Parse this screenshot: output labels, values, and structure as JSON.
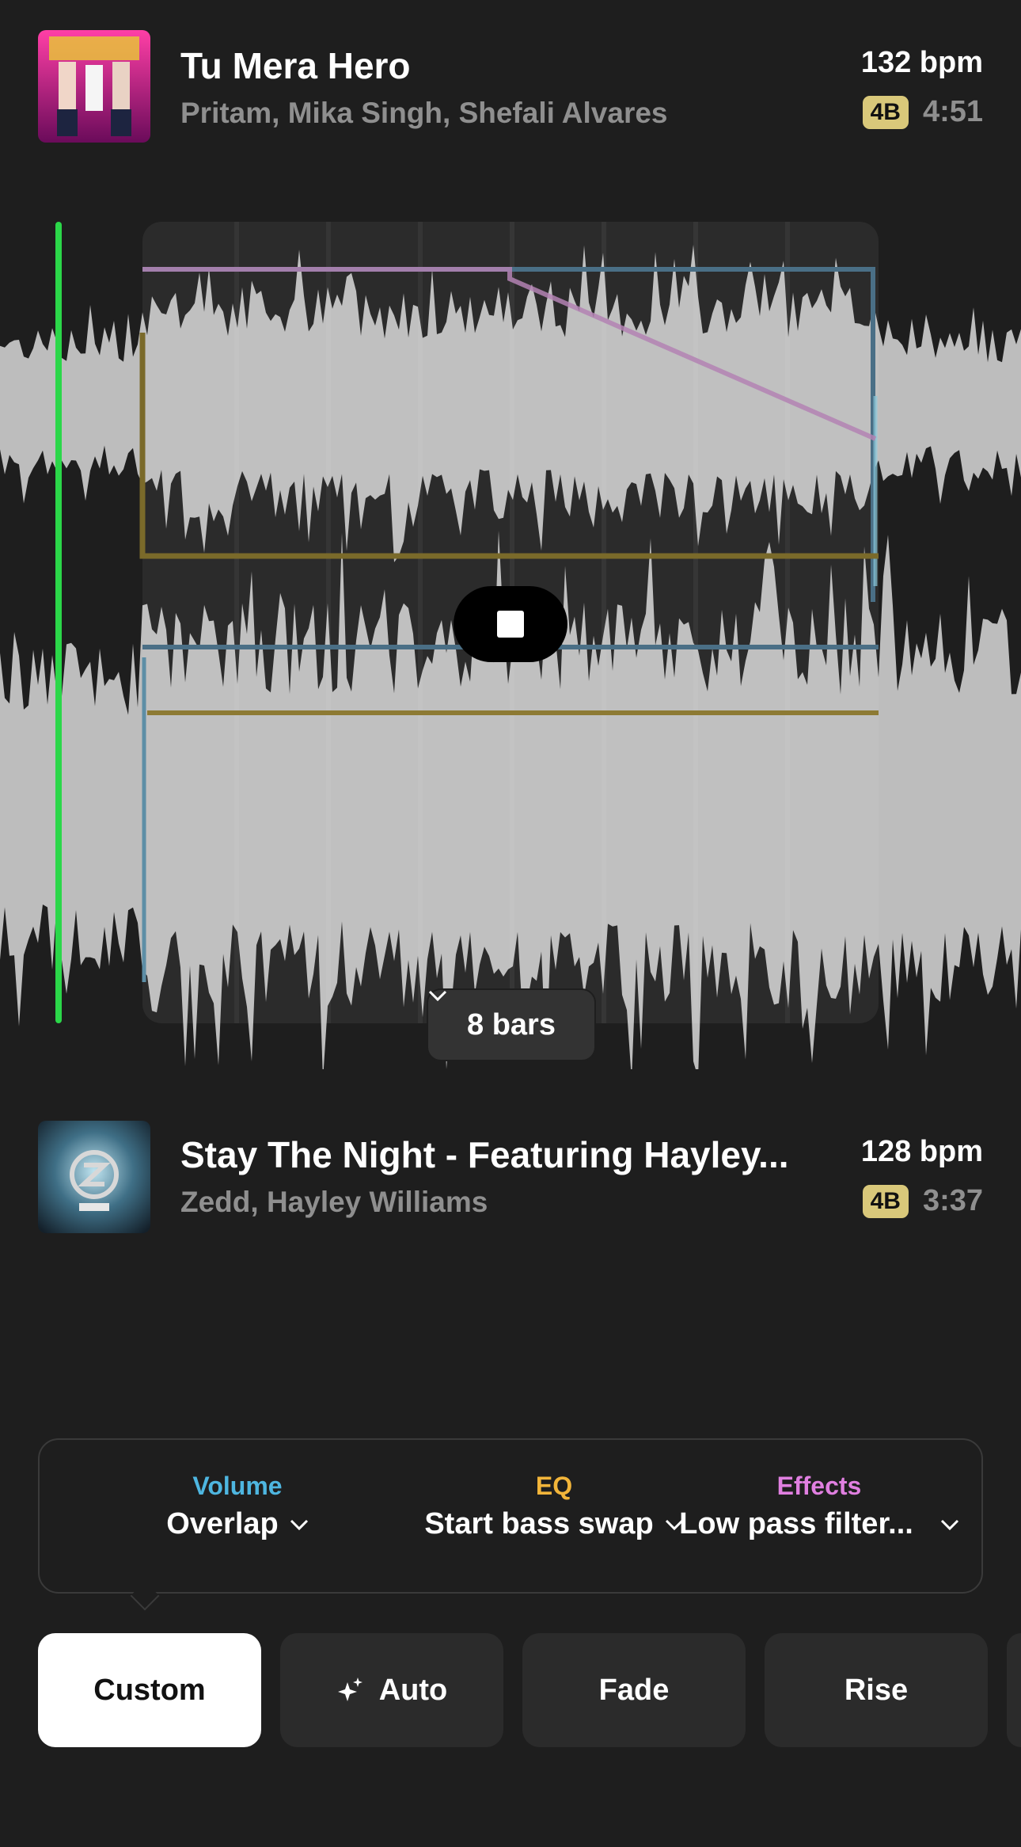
{
  "track_a": {
    "title": "Tu Mera Hero",
    "artist": "Pritam, Mika Singh, Shefali Alvares",
    "bpm": "132 bpm",
    "key": "4B",
    "duration": "4:51",
    "artwork_icon": "album-art-desi-boyz"
  },
  "track_b": {
    "title": "Stay The Night - Featuring Hayley...",
    "artist": "Zedd, Hayley Williams",
    "bpm": "128 bpm",
    "key": "4B",
    "duration": "3:37",
    "artwork_icon": "album-art-zedd"
  },
  "transition": {
    "length_label": "8 bars",
    "stop_icon": "stop-icon"
  },
  "controls": {
    "volume": {
      "label": "Volume",
      "value": "Overlap",
      "color": "#4eb6e0"
    },
    "eq": {
      "label": "EQ",
      "value": "Start bass swap",
      "color": "#f2b53a"
    },
    "effects": {
      "label": "Effects",
      "value": "Low pass filter...",
      "color": "#e07fe0"
    }
  },
  "presets": [
    {
      "label": "Custom",
      "active": true
    },
    {
      "label": "Auto",
      "icon": "sparkle-icon"
    },
    {
      "label": "Fade"
    },
    {
      "label": "Rise"
    }
  ],
  "colors": {
    "background": "#1e1e1e",
    "playhead": "#2bd749",
    "key_badge": "#d9c87a",
    "waveform": "#bdbdbd"
  }
}
